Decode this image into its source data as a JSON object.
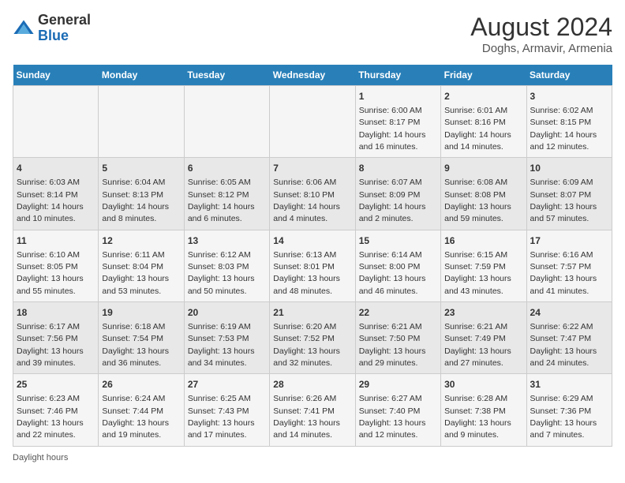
{
  "logo": {
    "text_general": "General",
    "text_blue": "Blue"
  },
  "title": "August 2024",
  "subtitle": "Doghs, Armavir, Armenia",
  "days_of_week": [
    "Sunday",
    "Monday",
    "Tuesday",
    "Wednesday",
    "Thursday",
    "Friday",
    "Saturday"
  ],
  "weeks": [
    [
      {
        "day": "",
        "info": ""
      },
      {
        "day": "",
        "info": ""
      },
      {
        "day": "",
        "info": ""
      },
      {
        "day": "",
        "info": ""
      },
      {
        "day": "1",
        "info": "Sunrise: 6:00 AM\nSunset: 8:17 PM\nDaylight: 14 hours and 16 minutes."
      },
      {
        "day": "2",
        "info": "Sunrise: 6:01 AM\nSunset: 8:16 PM\nDaylight: 14 hours and 14 minutes."
      },
      {
        "day": "3",
        "info": "Sunrise: 6:02 AM\nSunset: 8:15 PM\nDaylight: 14 hours and 12 minutes."
      }
    ],
    [
      {
        "day": "4",
        "info": "Sunrise: 6:03 AM\nSunset: 8:14 PM\nDaylight: 14 hours and 10 minutes."
      },
      {
        "day": "5",
        "info": "Sunrise: 6:04 AM\nSunset: 8:13 PM\nDaylight: 14 hours and 8 minutes."
      },
      {
        "day": "6",
        "info": "Sunrise: 6:05 AM\nSunset: 8:12 PM\nDaylight: 14 hours and 6 minutes."
      },
      {
        "day": "7",
        "info": "Sunrise: 6:06 AM\nSunset: 8:10 PM\nDaylight: 14 hours and 4 minutes."
      },
      {
        "day": "8",
        "info": "Sunrise: 6:07 AM\nSunset: 8:09 PM\nDaylight: 14 hours and 2 minutes."
      },
      {
        "day": "9",
        "info": "Sunrise: 6:08 AM\nSunset: 8:08 PM\nDaylight: 13 hours and 59 minutes."
      },
      {
        "day": "10",
        "info": "Sunrise: 6:09 AM\nSunset: 8:07 PM\nDaylight: 13 hours and 57 minutes."
      }
    ],
    [
      {
        "day": "11",
        "info": "Sunrise: 6:10 AM\nSunset: 8:05 PM\nDaylight: 13 hours and 55 minutes."
      },
      {
        "day": "12",
        "info": "Sunrise: 6:11 AM\nSunset: 8:04 PM\nDaylight: 13 hours and 53 minutes."
      },
      {
        "day": "13",
        "info": "Sunrise: 6:12 AM\nSunset: 8:03 PM\nDaylight: 13 hours and 50 minutes."
      },
      {
        "day": "14",
        "info": "Sunrise: 6:13 AM\nSunset: 8:01 PM\nDaylight: 13 hours and 48 minutes."
      },
      {
        "day": "15",
        "info": "Sunrise: 6:14 AM\nSunset: 8:00 PM\nDaylight: 13 hours and 46 minutes."
      },
      {
        "day": "16",
        "info": "Sunrise: 6:15 AM\nSunset: 7:59 PM\nDaylight: 13 hours and 43 minutes."
      },
      {
        "day": "17",
        "info": "Sunrise: 6:16 AM\nSunset: 7:57 PM\nDaylight: 13 hours and 41 minutes."
      }
    ],
    [
      {
        "day": "18",
        "info": "Sunrise: 6:17 AM\nSunset: 7:56 PM\nDaylight: 13 hours and 39 minutes."
      },
      {
        "day": "19",
        "info": "Sunrise: 6:18 AM\nSunset: 7:54 PM\nDaylight: 13 hours and 36 minutes."
      },
      {
        "day": "20",
        "info": "Sunrise: 6:19 AM\nSunset: 7:53 PM\nDaylight: 13 hours and 34 minutes."
      },
      {
        "day": "21",
        "info": "Sunrise: 6:20 AM\nSunset: 7:52 PM\nDaylight: 13 hours and 32 minutes."
      },
      {
        "day": "22",
        "info": "Sunrise: 6:21 AM\nSunset: 7:50 PM\nDaylight: 13 hours and 29 minutes."
      },
      {
        "day": "23",
        "info": "Sunrise: 6:21 AM\nSunset: 7:49 PM\nDaylight: 13 hours and 27 minutes."
      },
      {
        "day": "24",
        "info": "Sunrise: 6:22 AM\nSunset: 7:47 PM\nDaylight: 13 hours and 24 minutes."
      }
    ],
    [
      {
        "day": "25",
        "info": "Sunrise: 6:23 AM\nSunset: 7:46 PM\nDaylight: 13 hours and 22 minutes."
      },
      {
        "day": "26",
        "info": "Sunrise: 6:24 AM\nSunset: 7:44 PM\nDaylight: 13 hours and 19 minutes."
      },
      {
        "day": "27",
        "info": "Sunrise: 6:25 AM\nSunset: 7:43 PM\nDaylight: 13 hours and 17 minutes."
      },
      {
        "day": "28",
        "info": "Sunrise: 6:26 AM\nSunset: 7:41 PM\nDaylight: 13 hours and 14 minutes."
      },
      {
        "day": "29",
        "info": "Sunrise: 6:27 AM\nSunset: 7:40 PM\nDaylight: 13 hours and 12 minutes."
      },
      {
        "day": "30",
        "info": "Sunrise: 6:28 AM\nSunset: 7:38 PM\nDaylight: 13 hours and 9 minutes."
      },
      {
        "day": "31",
        "info": "Sunrise: 6:29 AM\nSunset: 7:36 PM\nDaylight: 13 hours and 7 minutes."
      }
    ]
  ],
  "footer": "Daylight hours"
}
